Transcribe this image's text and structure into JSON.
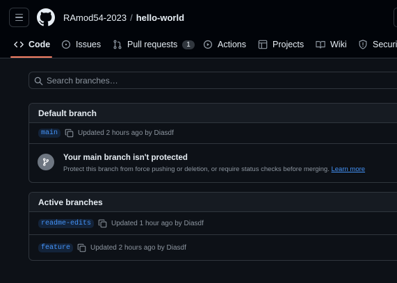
{
  "header": {
    "owner": "RAmod54-2023",
    "separator": "/",
    "repo": "hello-world"
  },
  "tabs": [
    {
      "label": "Code",
      "icon": "code-icon"
    },
    {
      "label": "Issues",
      "icon": "issue-opened-icon"
    },
    {
      "label": "Pull requests",
      "icon": "git-pull-request-icon",
      "counter": "1"
    },
    {
      "label": "Actions",
      "icon": "play-icon"
    },
    {
      "label": "Projects",
      "icon": "table-icon"
    },
    {
      "label": "Wiki",
      "icon": "book-icon"
    },
    {
      "label": "Security",
      "icon": "shield-icon"
    }
  ],
  "search": {
    "placeholder": "Search branches…",
    "value": ""
  },
  "default_branch": {
    "title": "Default branch",
    "branch": "main",
    "updated": "Updated 2 hours ago by Diasdf",
    "protect_title": "Your main branch isn't protected",
    "protect_desc": "Protect this branch from force pushing or deletion, or require status checks before merging.",
    "learn_more": "Learn more"
  },
  "active_branches": {
    "title": "Active branches",
    "items": [
      {
        "branch": "readme-edits",
        "updated": "Updated 1 hour ago by Diasdf"
      },
      {
        "branch": "feature",
        "updated": "Updated 2 hours ago by Diasdf"
      }
    ]
  },
  "colors": {
    "accent": "#f78166",
    "link": "#4493f8",
    "background": "#0d1117"
  }
}
